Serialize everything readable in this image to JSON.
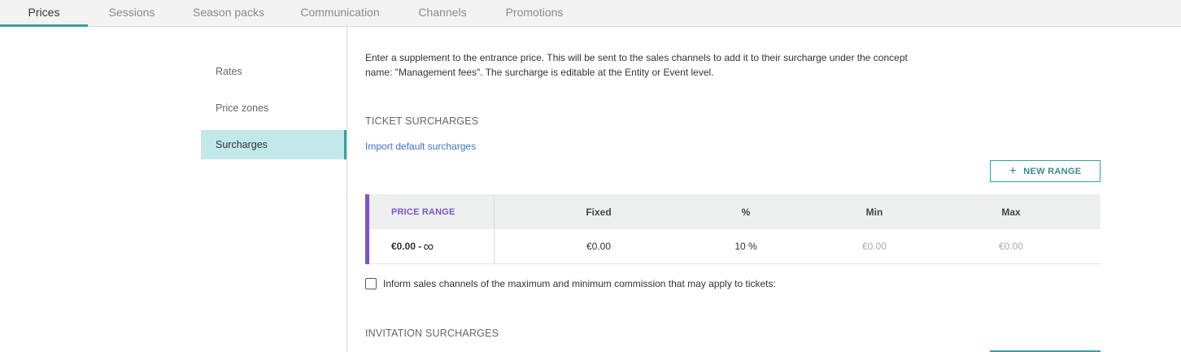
{
  "tabs": [
    {
      "label": "Prices",
      "active": true
    },
    {
      "label": "Sessions",
      "active": false
    },
    {
      "label": "Season packs",
      "active": false
    },
    {
      "label": "Communication",
      "active": false
    },
    {
      "label": "Channels",
      "active": false
    },
    {
      "label": "Promotions",
      "active": false
    }
  ],
  "sidebar": {
    "items": [
      {
        "label": "Rates",
        "active": false
      },
      {
        "label": "Price zones",
        "active": false
      },
      {
        "label": "Surcharges",
        "active": true
      }
    ]
  },
  "intro": "Enter a supplement to the entrance price. This will be sent to the sales channels to add it to their surcharge under the concept name: \"Management fees\". The surcharge is editable at the Entity or Event level.",
  "ticket_surcharges": {
    "title": "TICKET SURCHARGES",
    "import_link": "Import default surcharges",
    "new_range_label": "NEW RANGE",
    "table": {
      "headers": {
        "price_range": "PRICE RANGE",
        "fixed": "Fixed",
        "percent": "%",
        "min": "Min",
        "max": "Max"
      },
      "row": {
        "range_from": "€0.00 -",
        "range_to_icon": "infinity-icon",
        "fixed": "€0.00",
        "percent": "10 %",
        "min": "€0.00",
        "max": "€0.00"
      }
    },
    "inform_checkbox_label": "Inform sales channels of the maximum and minimum commission that may apply to tickets:",
    "inform_checked": false
  },
  "invitation_surcharges": {
    "title": "INVITATION SURCHARGES"
  },
  "colors": {
    "accent": "#3a9ea1",
    "active_side_bg": "#c2e8ea",
    "price_range_purple": "#7a57c7",
    "link": "#3a74c9"
  }
}
